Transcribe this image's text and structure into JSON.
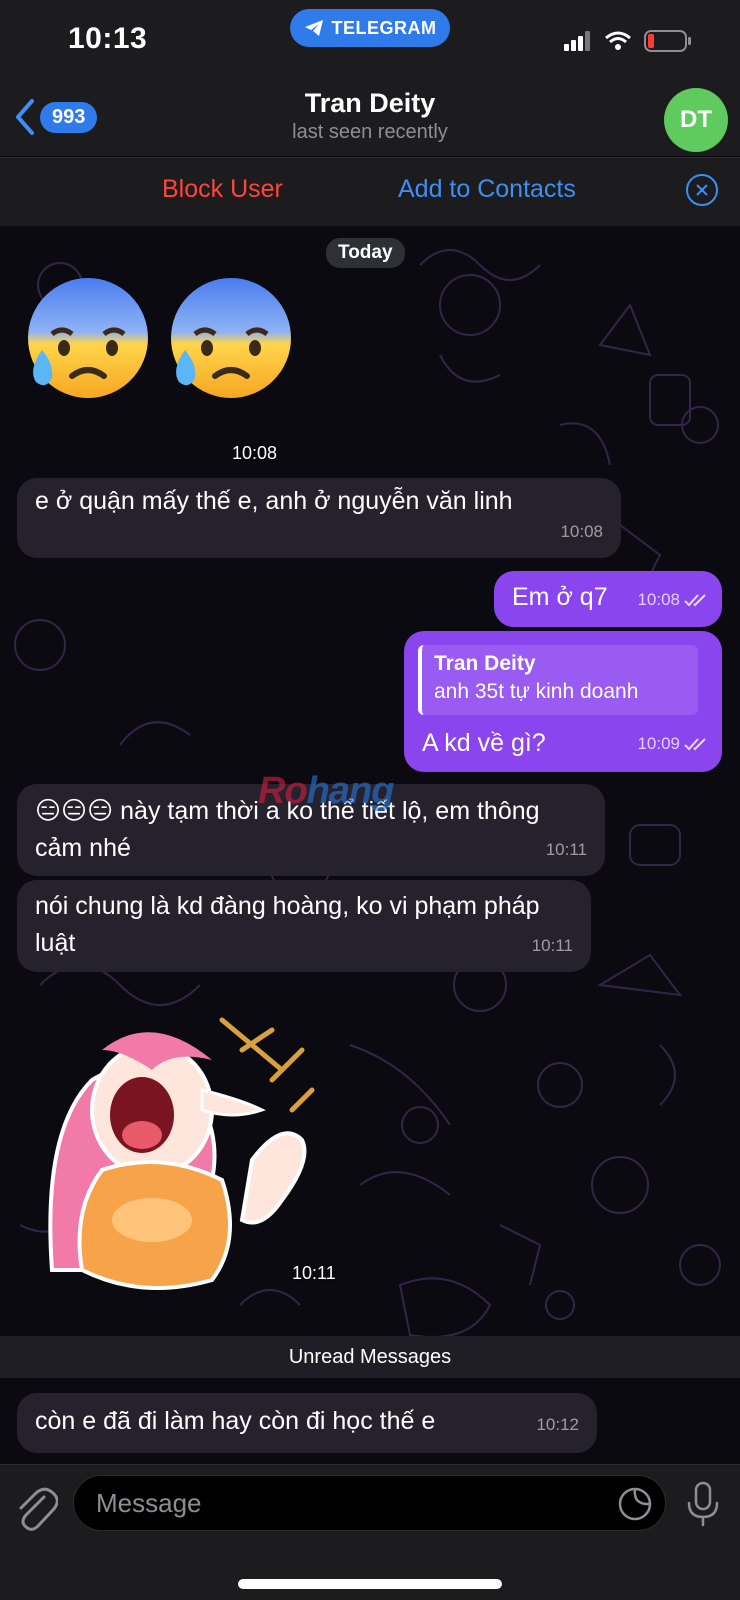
{
  "status_bar": {
    "time": "10:13",
    "app_pill": "TELEGRAM"
  },
  "header": {
    "back_badge": "993",
    "title": "Tran Deity",
    "subtitle": "last seen recently",
    "avatar_initials": "DT"
  },
  "action_bar": {
    "block_label": "Block User",
    "add_label": "Add to Contacts"
  },
  "chat": {
    "date_pill": "Today",
    "emoji_time": "10:08",
    "messages": [
      {
        "direction": "in",
        "text": "e ở quận mấy thế e, anh ở nguyễn văn linh",
        "time": "10:08"
      },
      {
        "direction": "out",
        "text": "Em ở q7",
        "time": "10:08",
        "read": true
      },
      {
        "direction": "out",
        "reply_name": "Tran Deity",
        "reply_text": "anh 35t tự kinh doanh",
        "text": "A kd về gì?",
        "time": "10:09",
        "read": true
      },
      {
        "direction": "in",
        "emoji_prefix": "😑😑😑",
        "text": " này tạm thời a ko thể tiết lộ, em thông cảm nhé",
        "time": "10:11"
      },
      {
        "direction": "in",
        "text": "nói chung là kd đàng hoàng, ko vi phạm pháp luật",
        "time": "10:11"
      },
      {
        "direction": "in",
        "text": "còn e đã đi làm hay còn đi học thế e",
        "time": "10:12"
      }
    ],
    "sticker_time": "10:11",
    "unread_label": "Unread Messages",
    "watermark": {
      "part1": "Ro",
      "part2": "hang"
    }
  },
  "input": {
    "placeholder": "Message"
  },
  "colors": {
    "accent": "#2f7bea",
    "outgoing_bubble": "#8b45ef",
    "incoming_bubble": "#25222e",
    "danger": "#ff453a",
    "avatar": "#5fcb5f"
  },
  "icons": [
    "telegram-plane-icon",
    "signal-icon",
    "wifi-icon",
    "battery-icon",
    "back-chevron-icon",
    "close-circle-icon",
    "double-check-icon",
    "paperclip-icon",
    "sticker-icon",
    "microphone-icon",
    "anxious-face-emoji",
    "girl-yelling-sticker"
  ]
}
